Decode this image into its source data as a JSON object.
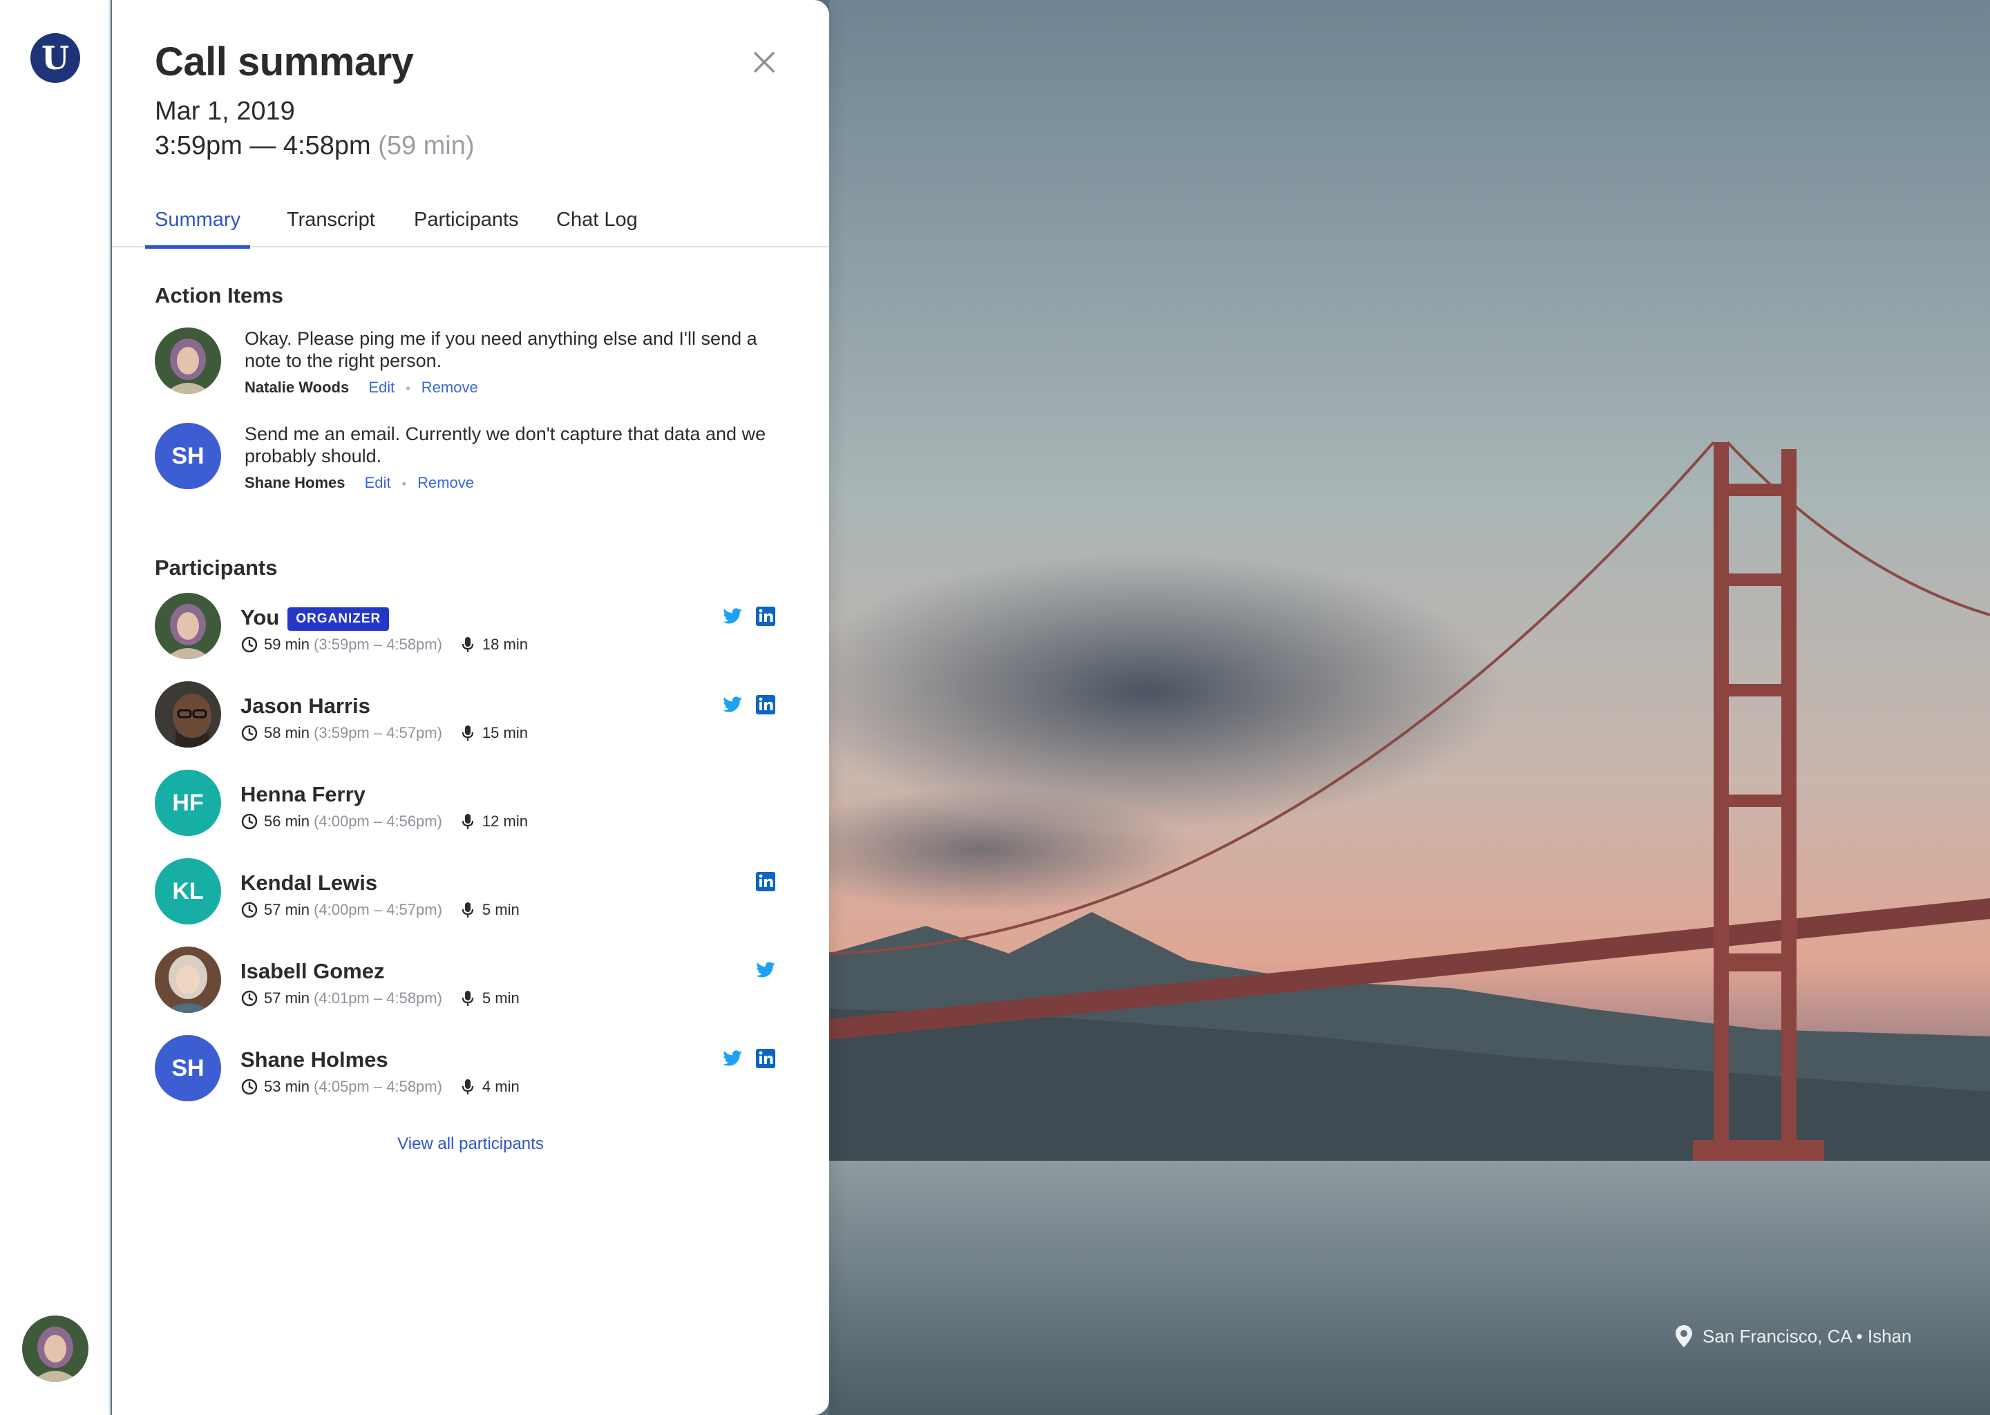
{
  "app": {
    "brand_letter": "U"
  },
  "panel": {
    "title": "Call summary",
    "date": "Mar 1, 2019",
    "time_range": "3:59pm — 4:58pm",
    "duration": "(59 min)"
  },
  "tabs": [
    {
      "label": "Summary",
      "active": true
    },
    {
      "label": "Transcript",
      "active": false
    },
    {
      "label": "Participants",
      "active": false
    },
    {
      "label": "Chat Log",
      "active": false
    }
  ],
  "action_items": {
    "title": "Action Items",
    "edit_label": "Edit",
    "remove_label": "Remove",
    "items": [
      {
        "text": "Okay. Please ping me if you need anything else and I'll send a note to the right person.",
        "author": "Natalie Woods"
      },
      {
        "text": "Send me an email. Currently we don't capture that data and we probably should.",
        "author": "Shane Homes",
        "initials": "SH"
      }
    ]
  },
  "participants": {
    "title": "Participants",
    "view_all": "View all participants",
    "items": [
      {
        "name": "You",
        "badge": "ORGANIZER",
        "duration": "59 min",
        "range": "(3:59pm – 4:58pm)",
        "talk": "18 min",
        "twitter": true,
        "linkedin": true
      },
      {
        "name": "Jason Harris",
        "duration": "58 min",
        "range": "(3:59pm – 4:57pm)",
        "talk": "15 min",
        "twitter": true,
        "linkedin": true
      },
      {
        "name": "Henna Ferry",
        "initials": "HF",
        "color": "#17aea6",
        "duration": "56 min",
        "range": "(4:00pm – 4:56pm)",
        "talk": "12 min",
        "twitter": false,
        "linkedin": false
      },
      {
        "name": "Kendal Lewis",
        "initials": "KL",
        "color": "#17aea6",
        "duration": "57 min",
        "range": "(4:00pm – 4:57pm)",
        "talk": "5 min",
        "twitter": false,
        "linkedin": true
      },
      {
        "name": "Isabell Gomez",
        "duration": "57 min",
        "range": "(4:01pm – 4:58pm)",
        "talk": "5 min",
        "twitter": true,
        "linkedin": false
      },
      {
        "name": "Shane Holmes",
        "initials": "SH",
        "color": "#3d5ed3",
        "duration": "53 min",
        "range": "(4:05pm – 4:58pm)",
        "talk": "4 min",
        "twitter": true,
        "linkedin": true
      }
    ]
  },
  "background": {
    "caption": "San Francisco, CA • Ishan"
  },
  "colors": {
    "accent": "#2f53c9",
    "brand": "#1e3378",
    "twitter": "#1da1f2",
    "linkedin": "#0a66c2",
    "badge": "#2338c6"
  }
}
